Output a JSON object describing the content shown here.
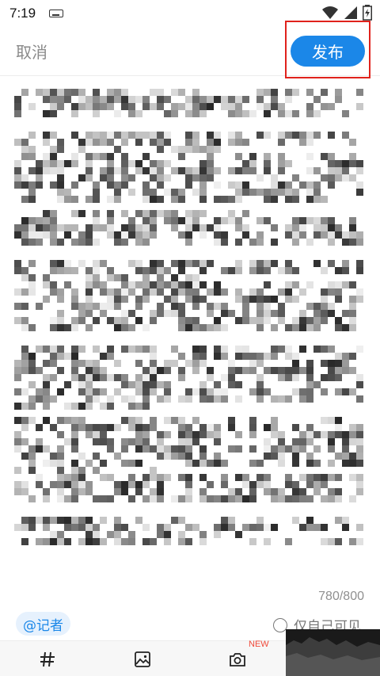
{
  "status_bar": {
    "time": "7:19"
  },
  "header": {
    "cancel_label": "取消",
    "publish_label": "发布"
  },
  "editor": {
    "char_count": "780/800"
  },
  "footer": {
    "mention_label": "@记者",
    "private_label": "仅自己可见",
    "new_badge": "NEW"
  },
  "colors": {
    "accent": "#1b87e8",
    "highlight_box": "#e0221c",
    "new_badge": "#f04a3a"
  }
}
